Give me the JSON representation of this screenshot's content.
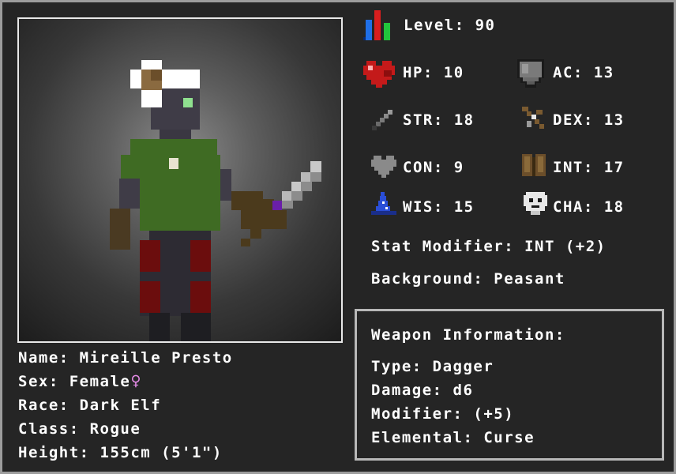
{
  "character": {
    "name_line": "Name: Mireille Presto",
    "sex_line": "Sex: Female",
    "sex_icon": "female-symbol-icon",
    "sex_glyph": "♀",
    "race_line": "Race: Dark Elf",
    "class_line": "Class: Rogue",
    "height_line": "Height: 155cm (5'1\")"
  },
  "stats": {
    "level": "Level: 90",
    "hp": "HP: 10",
    "ac": "AC: 13",
    "str": "STR: 18",
    "dex": "DEX: 13",
    "con": "CON: 9",
    "int": "INT: 17",
    "wis": "WIS: 15",
    "cha": "CHA: 18",
    "modifier": "Stat Modifier: INT (+2)",
    "background": "Background: Peasant"
  },
  "weapon": {
    "title": "Weapon Information:",
    "type": "Type: Dagger",
    "damage": "Damage: d6",
    "modifier": "Modifier: (+5)",
    "elemental": "Elemental: Curse"
  },
  "colors": {
    "background": "#252525",
    "text": "#ffffff",
    "female_symbol": "#e68ce8",
    "hp_heart": "#c41a1a",
    "level_bar_blue": "#1f6fe8",
    "level_bar_red": "#d81e1e",
    "level_bar_green": "#22c43c"
  }
}
